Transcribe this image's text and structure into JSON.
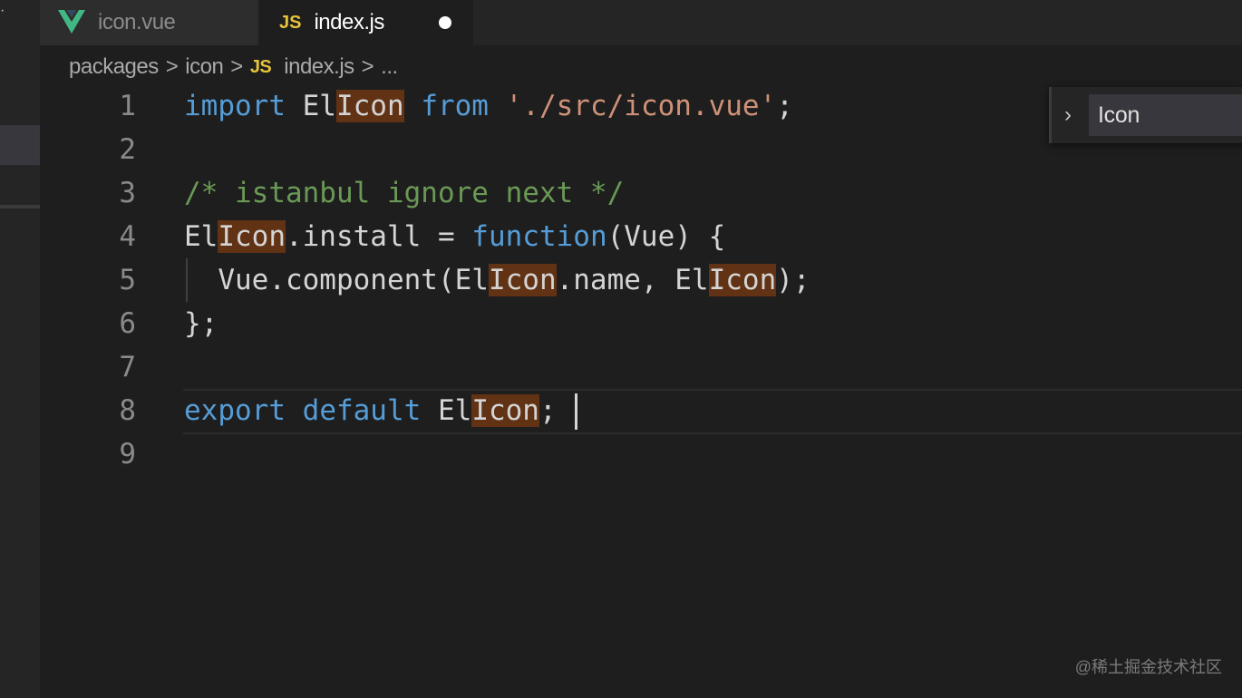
{
  "tabs": [
    {
      "label": "icon.vue",
      "icon": "vue-logo-icon",
      "active": false
    },
    {
      "label": "index.js",
      "icon": "js-file-icon",
      "badge": "JS",
      "active": true,
      "dirty": true
    }
  ],
  "breadcrumb": {
    "items": [
      "packages",
      "icon",
      "index.js",
      "..."
    ],
    "file_badge": "JS",
    "separator": ">"
  },
  "editor": {
    "language": "javascript",
    "cursor_line": 8,
    "lines": [
      {
        "n": "1",
        "text": "import ElIcon from './src/icon.vue';"
      },
      {
        "n": "2",
        "text": ""
      },
      {
        "n": "3",
        "text": "/* istanbul ignore next */"
      },
      {
        "n": "4",
        "text": "ElIcon.install = function(Vue) {"
      },
      {
        "n": "5",
        "text": "  Vue.component(ElIcon.name, ElIcon);"
      },
      {
        "n": "6",
        "text": "};"
      },
      {
        "n": "7",
        "text": ""
      },
      {
        "n": "8",
        "text": "export default ElIcon; "
      },
      {
        "n": "9",
        "text": ""
      }
    ],
    "highlighted_term": "Icon"
  },
  "symbol_popup": {
    "item": "Icon"
  },
  "watermark": "@稀土掘金技术社区",
  "colors": {
    "keyword": "#569cd6",
    "string": "#ce9178",
    "comment": "#6a9955",
    "text": "#d4d4d4",
    "match_highlight": "#613214",
    "vue_green": "#41b883",
    "js_yellow": "#e5c33a"
  }
}
